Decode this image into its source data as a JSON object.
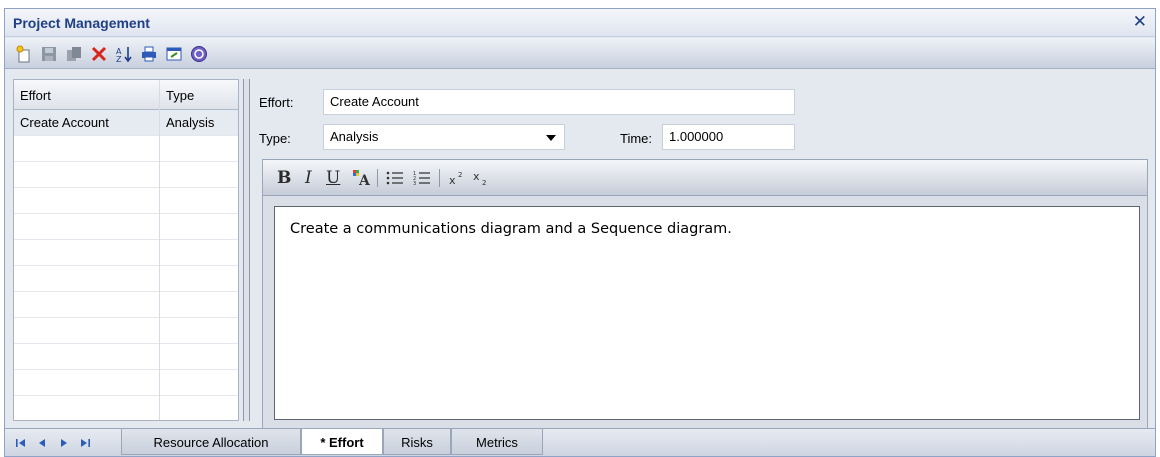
{
  "window": {
    "title": "Project Management",
    "close_icon": "close-icon"
  },
  "toolbar": {
    "icons": [
      "new-icon",
      "save-icon",
      "copy-icon",
      "delete-icon",
      "sort-icon",
      "print-icon",
      "properties-icon",
      "help-icon"
    ]
  },
  "grid": {
    "columns": [
      "Effort",
      "Type"
    ],
    "rows": [
      {
        "effort": "Create Account",
        "type": "Analysis"
      }
    ]
  },
  "form": {
    "effort_label": "Effort:",
    "effort_value": "Create Account",
    "type_label": "Type:",
    "type_value": "Analysis",
    "time_label": "Time:",
    "time_value": "1.000000"
  },
  "editor": {
    "bold": "B",
    "italic": "I",
    "underline": "U",
    "content": "Create a communications diagram and a Sequence diagram."
  },
  "tabs": {
    "items": [
      "Resource Allocation",
      "* Effort",
      "Risks",
      "Metrics"
    ],
    "active": "* Effort"
  },
  "colors": {
    "title_text": "#1f3f87",
    "delete": "#d9261c",
    "accent": "#2d5bb8"
  }
}
